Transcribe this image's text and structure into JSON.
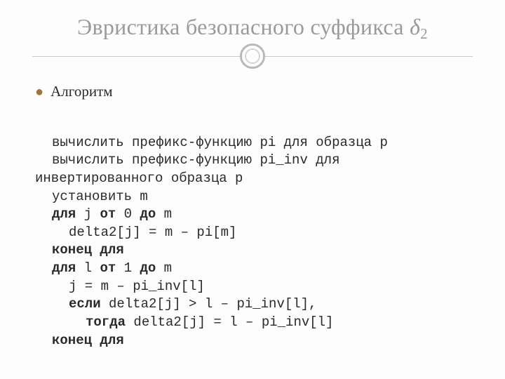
{
  "title": {
    "main": "Эвристика безопасного суффикса ",
    "delta": "δ",
    "sub": "2"
  },
  "bullet": {
    "glyph": "●",
    "label": "Алгоритм"
  },
  "code": {
    "l1": "вычислить префикс-функцию pi для образца p",
    "l2": "вычислить префикс-функцию pi_inv для",
    "l3": "инвертированного образца p",
    "l4": "установить m",
    "l5a": "для",
    "l5b": " j ",
    "l5c": "от",
    "l5d": " 0 ",
    "l5e": "до",
    "l5f": " m",
    "l6": "delta2[j] = m – pi[m]",
    "l7": "конец для",
    "l8a": "для",
    "l8b": " l ",
    "l8c": "от",
    "l8d": " 1 ",
    "l8e": "до",
    "l8f": " m",
    "l9": "j = m – pi_inv[l]",
    "l10a": "если",
    "l10b": " delta2[j] > l – pi_inv[l],",
    "l11a": "тогда",
    "l11b": " delta2[j] = l – pi_inv[l]",
    "l12": "конец для"
  }
}
